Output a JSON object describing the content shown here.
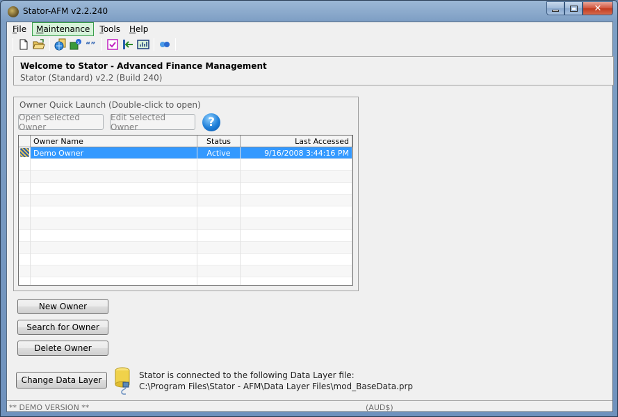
{
  "window": {
    "title": "Stator-AFM v2.2.240",
    "controls": {
      "minimize": "minimize",
      "maximize": "maximize",
      "close": "✕"
    }
  },
  "menu": {
    "items": [
      {
        "label": "File",
        "accel": "F"
      },
      {
        "label": "Maintenance",
        "accel": "M",
        "active": true
      },
      {
        "label": "Tools",
        "accel": "T"
      },
      {
        "label": "Help",
        "accel": "H"
      }
    ]
  },
  "toolbar": {
    "icons": [
      "new-document-icon",
      "open-folder-icon",
      "owner-details-icon",
      "export-owner-icon",
      "quote-icon",
      "checkbox-icon",
      "import-icon",
      "chart-icon",
      "help-arrows-icon"
    ]
  },
  "welcome": {
    "title": "Welcome to Stator - Advanced Finance Management",
    "subtitle": "Stator (Standard) v2.2 (Build 240)"
  },
  "quick_launch": {
    "label": "Owner Quick Launch (Double-click to open)",
    "open_button": "Open Selected Owner",
    "edit_button": "Edit Selected Owner",
    "help_glyph": "?",
    "columns": [
      "Owner Name",
      "Status",
      "Last Accessed"
    ],
    "rows": [
      {
        "name": "Demo Owner",
        "status": "Active",
        "last_accessed": "9/16/2008 3:44:16 PM",
        "selected": true
      }
    ],
    "empty_rows": 11
  },
  "actions": {
    "new_owner": "New Owner",
    "search_owner": "Search for Owner",
    "delete_owner": "Delete Owner",
    "change_data_layer": "Change Data Layer"
  },
  "data_layer": {
    "line1": "Stator is connected to the following Data Layer file:",
    "path": "C:\\Program Files\\Stator - AFM\\Data Layer Files\\mod_BaseData.prp"
  },
  "status": {
    "left": "** DEMO VERSION **",
    "currency": "(AUD$)"
  }
}
